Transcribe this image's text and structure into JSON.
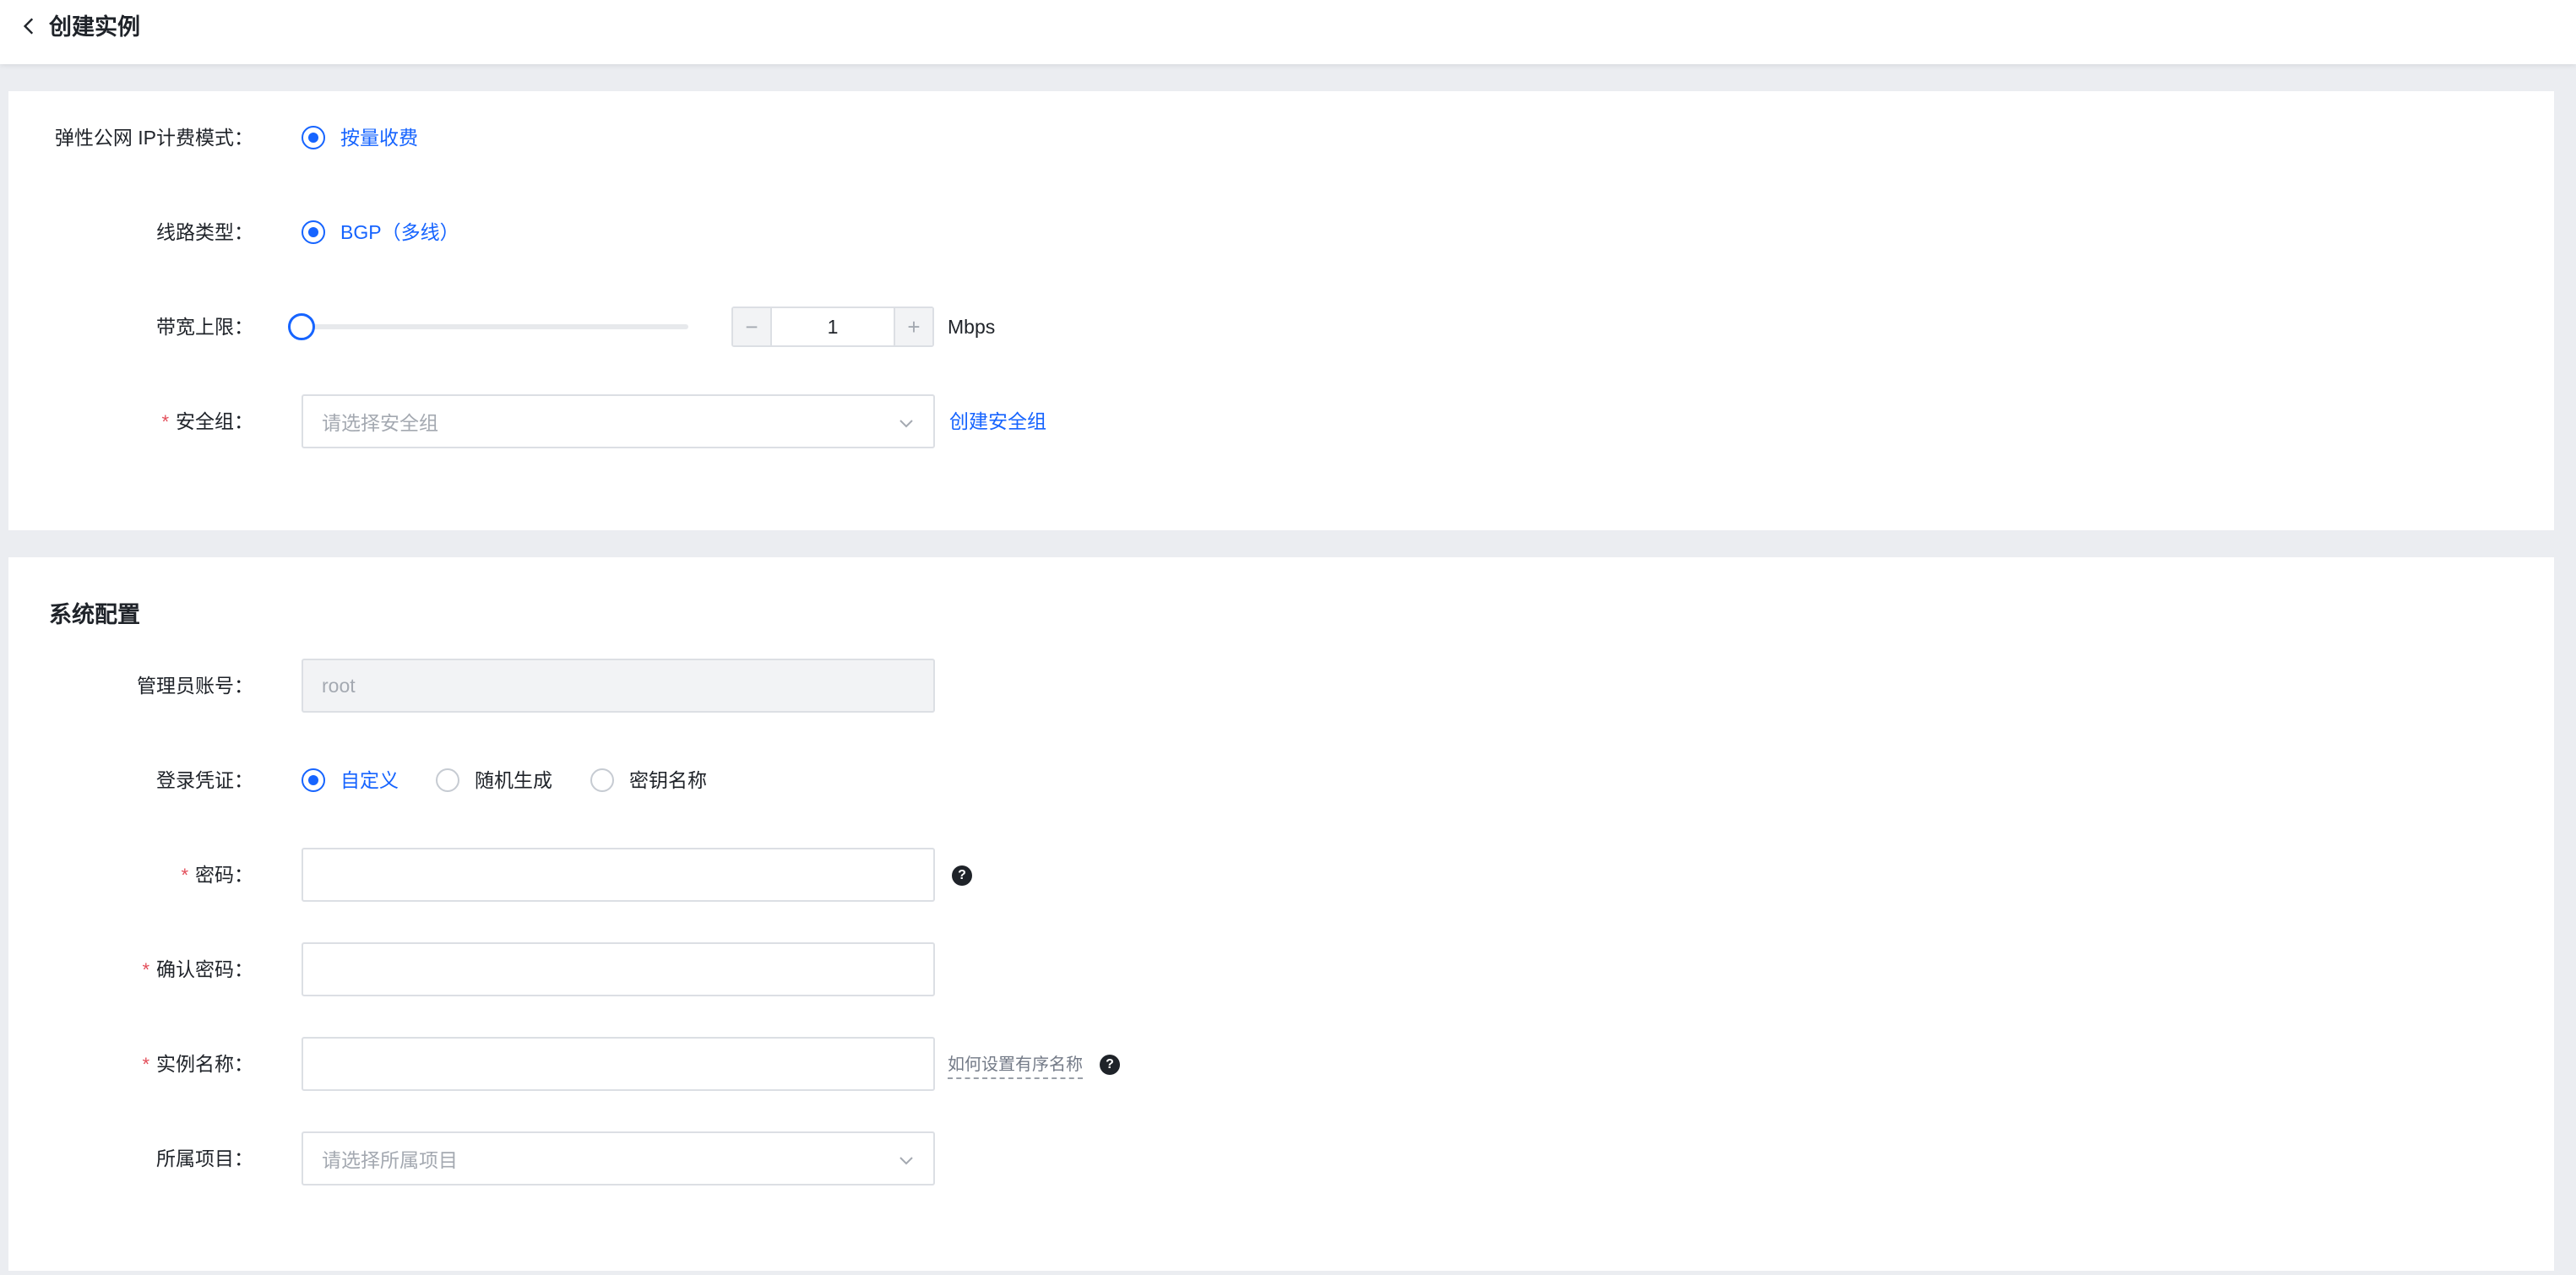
{
  "header": {
    "title": "创建实例"
  },
  "network": {
    "billing": {
      "label": "弹性公网 IP计费模式：",
      "option": "按量收费"
    },
    "line": {
      "label": "线路类型：",
      "option": "BGP（多线）"
    },
    "bandwidth": {
      "label": "带宽上限：",
      "value": "1",
      "unit": "Mbps",
      "minus": "−",
      "plus": "+",
      "slider_fraction": 0
    },
    "security_group": {
      "required_mark": "*",
      "label": "安全组：",
      "placeholder": "请选择安全组",
      "create_link": "创建安全组"
    }
  },
  "system": {
    "title": "系统配置",
    "admin": {
      "label": "管理员账号：",
      "value": "root"
    },
    "login": {
      "label": "登录凭证：",
      "options": [
        "自定义",
        "随机生成",
        "密钥名称"
      ],
      "selected": "自定义"
    },
    "password": {
      "required_mark": "*",
      "label": "密码：",
      "value": ""
    },
    "confirm_password": {
      "required_mark": "*",
      "label": "确认密码：",
      "value": ""
    },
    "instance_name": {
      "required_mark": "*",
      "label": "实例名称：",
      "value": "",
      "hint_link": "如何设置有序名称"
    },
    "project": {
      "label": "所属项目：",
      "placeholder": "请选择所属项目"
    }
  },
  "icons": {
    "help": "?"
  },
  "colors": {
    "accent": "#1664ff",
    "required": "#e34d59",
    "page_bg": "#ebedf1"
  }
}
